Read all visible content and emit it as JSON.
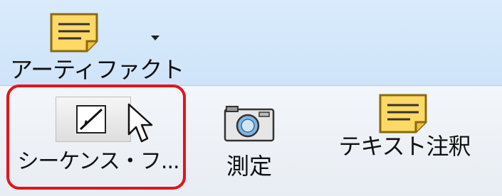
{
  "ribbon": {
    "artifact_button": {
      "label": "アーティファクト",
      "icon": "note-icon",
      "dropdown_icon": "dropdown-arrow-icon"
    }
  },
  "panel": {
    "items": [
      {
        "label": "シーケンス・フ...",
        "icon": "sequence-flow-icon",
        "highlighted": true
      },
      {
        "label": "測定",
        "icon": "camera-icon"
      },
      {
        "label": "テキスト注釈",
        "icon": "text-annotation-icon"
      }
    ]
  },
  "colors": {
    "highlight": "#e3141b",
    "note_fill": "#ffd966",
    "ribbon_bg": "#d6e9fb"
  }
}
